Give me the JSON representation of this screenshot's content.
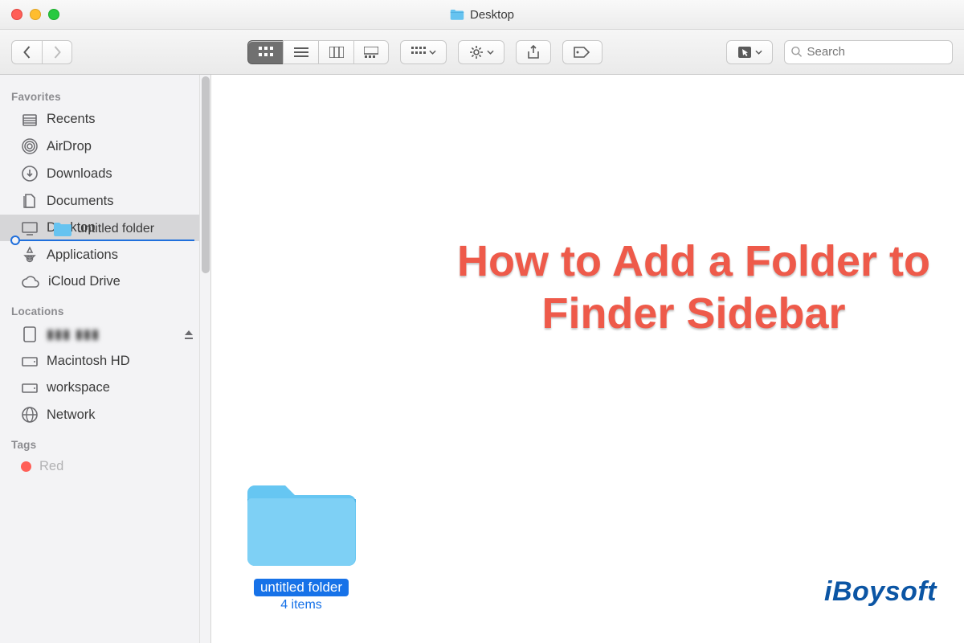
{
  "window": {
    "title": "Desktop"
  },
  "toolbar": {
    "search_placeholder": "Search"
  },
  "sidebar": {
    "favorites_heading": "Favorites",
    "items": [
      {
        "label": "Recents"
      },
      {
        "label": "AirDrop"
      },
      {
        "label": "Downloads"
      },
      {
        "label": "Documents"
      },
      {
        "label": "Desktop"
      },
      {
        "label": "Applications"
      },
      {
        "label": "iCloud Drive"
      }
    ],
    "locations_heading": "Locations",
    "locations": [
      {
        "label": ""
      },
      {
        "label": "Macintosh HD"
      },
      {
        "label": "workspace"
      },
      {
        "label": "Network"
      }
    ],
    "tags_heading": "Tags",
    "tags": [
      {
        "label": "Red",
        "color": "#ff5f57"
      }
    ],
    "drag_ghost_label": "untitled folder"
  },
  "main": {
    "folder": {
      "name": "untitled folder",
      "subtitle": "4 items"
    }
  },
  "overlay": {
    "headline": "How to Add a Folder to Finder Sidebar"
  },
  "brand": "iBoysoft"
}
